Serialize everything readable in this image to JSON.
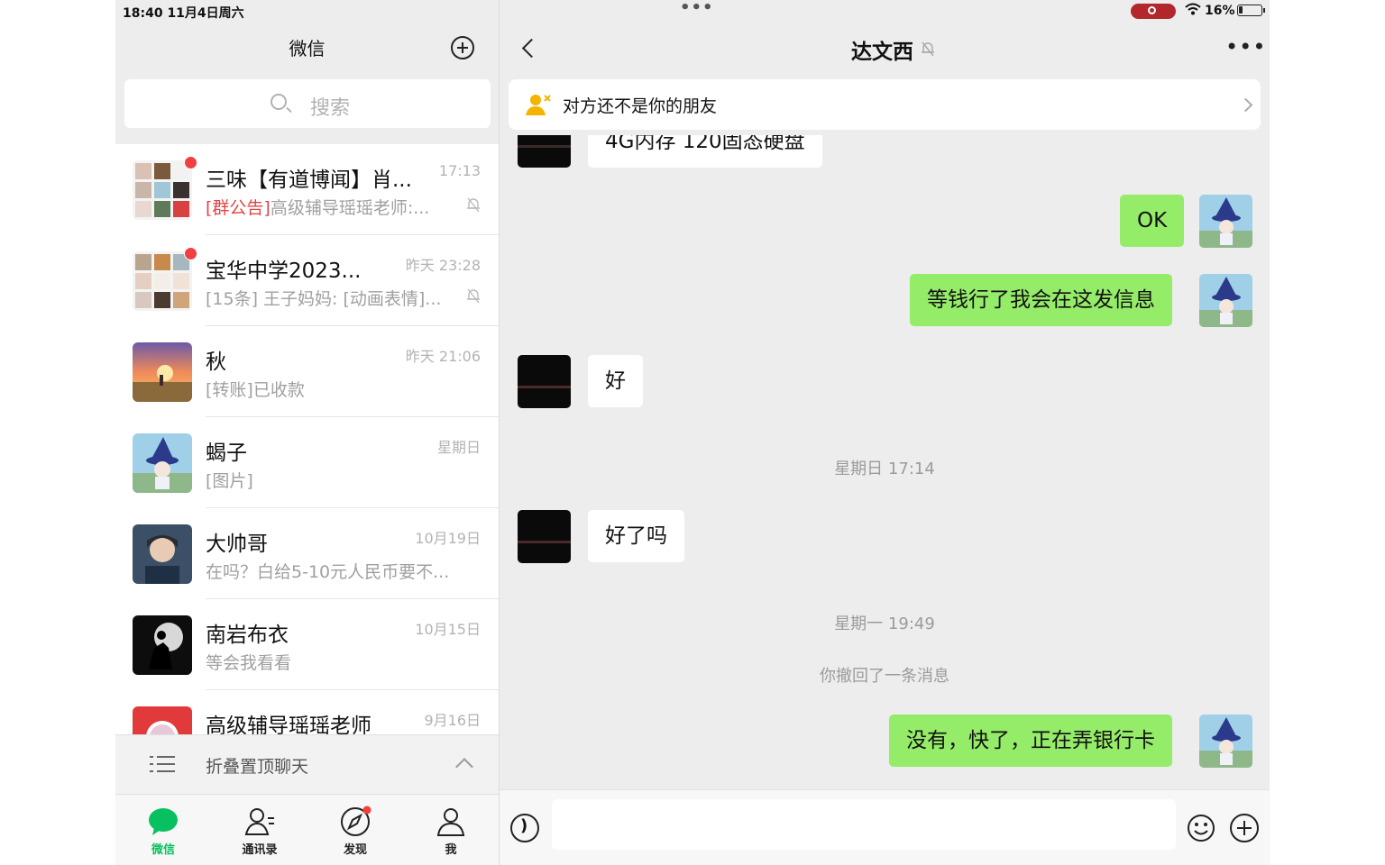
{
  "status": {
    "time": "18:40   11月4日周六",
    "dots": "•••",
    "wifi": "wifi",
    "battery": "16%"
  },
  "left": {
    "title": "微信",
    "search_placeholder": "搜索",
    "chats": [
      {
        "name": "三味【有道博闻】肖...",
        "time": "17:13",
        "tag": "[群公告]",
        "preview": "高级辅导瑶瑶老师:...",
        "muted": true,
        "unread": true
      },
      {
        "name": "宝华中学2023...",
        "time": "昨天 23:28",
        "tag": "",
        "preview": "[15条] 王子妈妈: [动画表情]...",
        "muted": true,
        "unread": true
      },
      {
        "name": "秋",
        "time": "昨天 21:06",
        "tag": "",
        "preview": "[转账]已收款",
        "muted": false,
        "unread": false
      },
      {
        "name": "蝎子",
        "time": "星期日",
        "tag": "",
        "preview": "[图片]",
        "muted": false,
        "unread": false
      },
      {
        "name": "大帅哥",
        "time": "10月19日",
        "tag": "",
        "preview": "在吗？白给5-10元人民币要不...",
        "muted": false,
        "unread": false
      },
      {
        "name": "南岩布衣",
        "time": "10月15日",
        "tag": "",
        "preview": "等会我看看",
        "muted": false,
        "unread": false
      },
      {
        "name": "高级辅导瑶瑶老师",
        "time": "9月16日",
        "tag": "",
        "preview": "",
        "muted": false,
        "unread": false
      }
    ],
    "fold_label": "折叠置顶聊天",
    "tabs": [
      {
        "label": "微信",
        "icon": "chat-bubble-icon",
        "active": true
      },
      {
        "label": "通讯录",
        "icon": "contacts-icon",
        "active": false
      },
      {
        "label": "发现",
        "icon": "compass-icon",
        "active": false
      },
      {
        "label": "我",
        "icon": "person-icon",
        "active": false
      }
    ]
  },
  "chat": {
    "title": "达文西",
    "banner": "对方还不是你的朋友",
    "partial_message": "4G内存 120固态硬盘",
    "messages": [
      {
        "dir": "out",
        "text": "OK"
      },
      {
        "dir": "out",
        "text": "等钱行了我会在这发信息"
      },
      {
        "dir": "in",
        "text": "好"
      },
      {
        "type": "time",
        "text": "星期日 17:14"
      },
      {
        "dir": "in",
        "text": "好了吗"
      },
      {
        "type": "time",
        "text": "星期一 19:49"
      },
      {
        "type": "system",
        "text": "你撤回了一条消息"
      },
      {
        "dir": "out",
        "text": "没有，快了，正在弄银行卡"
      }
    ]
  },
  "colors": {
    "accent": "#07c160",
    "bubble_out": "#95ec69",
    "unread_dot": "#f04040",
    "tag_red": "#e04646"
  }
}
